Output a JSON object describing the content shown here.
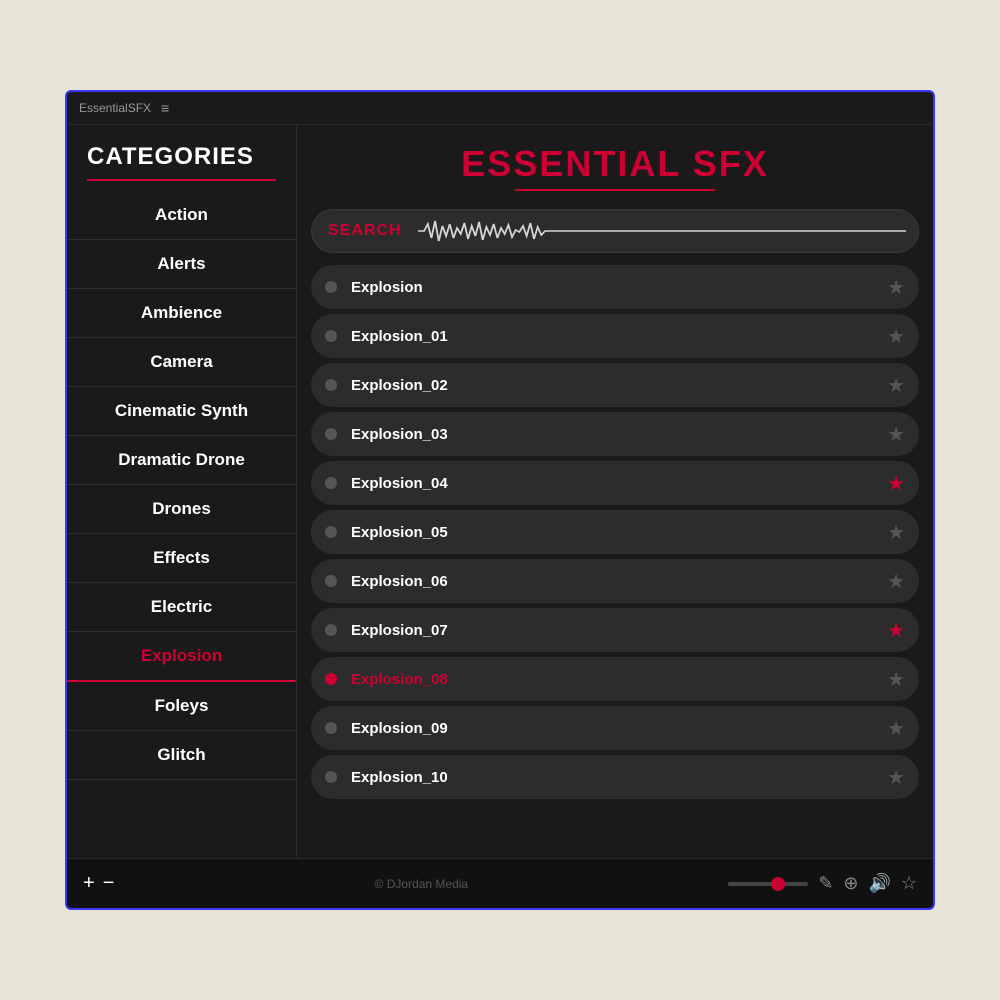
{
  "titleBar": {
    "appName": "EssentialSFX",
    "menuIcon": "≡"
  },
  "appTitle": {
    "part1": "ESSENTIAL",
    "part2": "SFX"
  },
  "search": {
    "label": "SEARCH"
  },
  "sidebar": {
    "title": "CATEGORIES",
    "items": [
      {
        "id": "action",
        "label": "Action",
        "active": false
      },
      {
        "id": "alerts",
        "label": "Alerts",
        "active": false
      },
      {
        "id": "ambience",
        "label": "Ambience",
        "active": false
      },
      {
        "id": "camera",
        "label": "Camera",
        "active": false
      },
      {
        "id": "cinematic-synth",
        "label": "Cinematic Synth",
        "active": false
      },
      {
        "id": "dramatic-drone",
        "label": "Dramatic Drone",
        "active": false
      },
      {
        "id": "drones",
        "label": "Drones",
        "active": false
      },
      {
        "id": "effects",
        "label": "Effects",
        "active": false
      },
      {
        "id": "electric",
        "label": "Electric",
        "active": false
      },
      {
        "id": "explosion",
        "label": "Explosion",
        "active": true
      },
      {
        "id": "foleys",
        "label": "Foleys",
        "active": false
      },
      {
        "id": "glitch",
        "label": "Glitch",
        "active": false
      }
    ]
  },
  "soundList": {
    "items": [
      {
        "id": 0,
        "name": "Explosion",
        "playing": false,
        "favorited": false
      },
      {
        "id": 1,
        "name": "Explosion_01",
        "playing": false,
        "favorited": false
      },
      {
        "id": 2,
        "name": "Explosion_02",
        "playing": false,
        "favorited": false
      },
      {
        "id": 3,
        "name": "Explosion_03",
        "playing": false,
        "favorited": false
      },
      {
        "id": 4,
        "name": "Explosion_04",
        "playing": false,
        "favorited": true
      },
      {
        "id": 5,
        "name": "Explosion_05",
        "playing": false,
        "favorited": false
      },
      {
        "id": 6,
        "name": "Explosion_06",
        "playing": false,
        "favorited": false
      },
      {
        "id": 7,
        "name": "Explosion_07",
        "playing": false,
        "favorited": true
      },
      {
        "id": 8,
        "name": "Explosion_08",
        "playing": true,
        "favorited": false
      },
      {
        "id": 9,
        "name": "Explosion_09",
        "playing": false,
        "favorited": false
      },
      {
        "id": 10,
        "name": "Explosion_10",
        "playing": false,
        "favorited": false
      }
    ]
  },
  "bottomBar": {
    "plusLabel": "+",
    "minusLabel": "−",
    "copyright": "© DJordan Media",
    "volumePercent": 55
  }
}
